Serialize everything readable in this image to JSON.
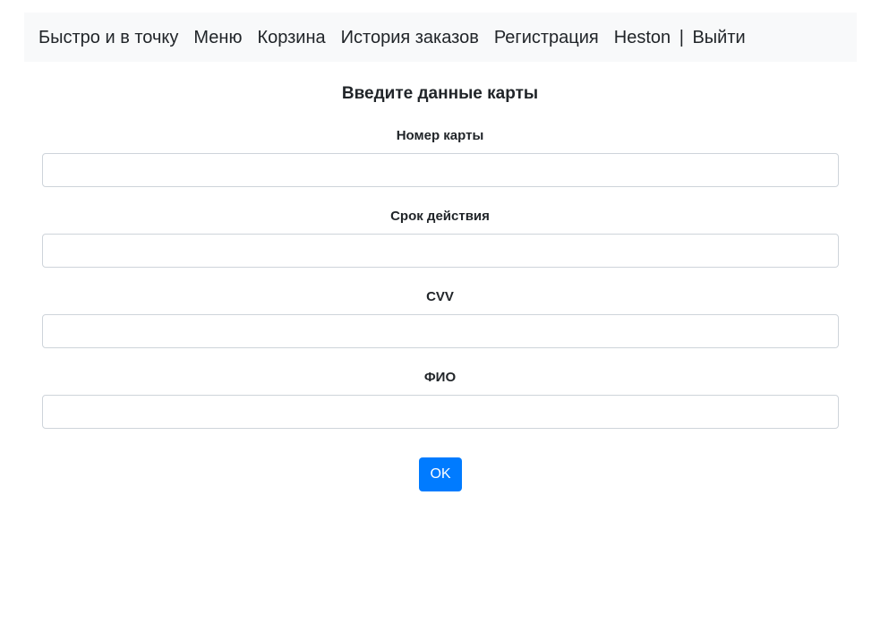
{
  "navbar": {
    "brand": "Быстро и в точку",
    "links": [
      "Меню",
      "Корзина",
      "История заказов",
      "Регистрация"
    ],
    "user": {
      "name": "Heston",
      "separator": "|",
      "logout": "Выйти"
    }
  },
  "form": {
    "title": "Введите данные карты",
    "fields": [
      {
        "label": "Номер карты",
        "value": ""
      },
      {
        "label": "Срок действия",
        "value": ""
      },
      {
        "label": "CVV",
        "value": ""
      },
      {
        "label": "ФИО",
        "value": ""
      }
    ],
    "submit_label": "OK"
  },
  "colors": {
    "navbar_bg": "#f8f9fa",
    "primary": "#007bff",
    "input_border": "#ced4da"
  }
}
